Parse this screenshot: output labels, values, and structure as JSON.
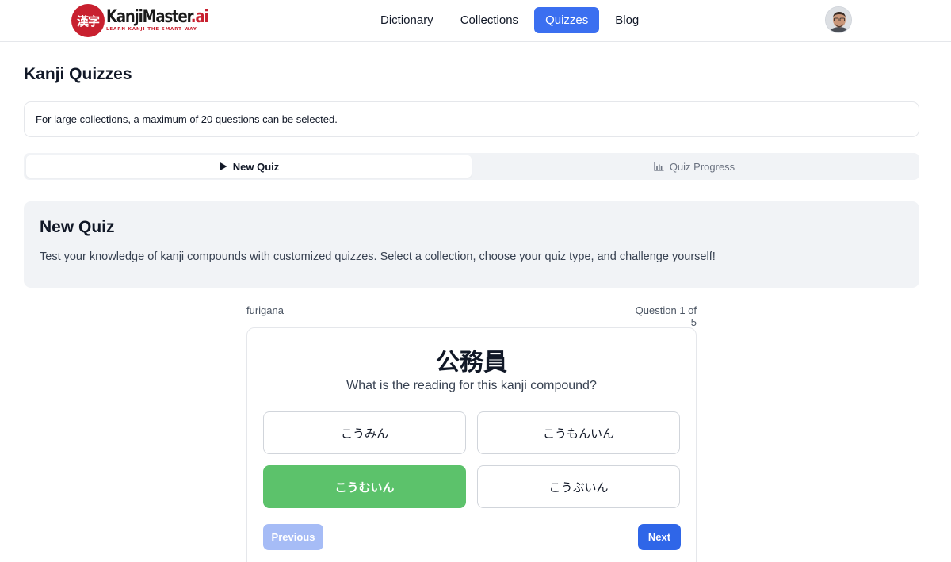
{
  "header": {
    "logo": {
      "mark": "漢字",
      "name": "KanjiMaster",
      "name_suffix": ".ai",
      "tagline": "LEARN KANJI THE SMART WAY"
    },
    "nav": [
      {
        "label": "Dictionary",
        "active": false
      },
      {
        "label": "Collections",
        "active": false
      },
      {
        "label": "Quizzes",
        "active": true
      },
      {
        "label": "Blog",
        "active": false
      }
    ]
  },
  "page": {
    "title": "Kanji Quizzes",
    "notice": "For large collections, a maximum of 20 questions can be selected."
  },
  "tabs": [
    {
      "label": "New Quiz",
      "icon": "play-icon",
      "active": true
    },
    {
      "label": "Quiz Progress",
      "icon": "chart-icon",
      "active": false
    }
  ],
  "hero": {
    "title": "New Quiz",
    "description": "Test your knowledge of kanji compounds with customized quizzes. Select a collection, choose your quiz type, and challenge yourself!"
  },
  "quiz": {
    "type": "furigana",
    "progress": "Question 1 of 5",
    "kanji": "公務員",
    "question": "What is the reading for this kanji compound?",
    "options": [
      "こうみん",
      "こうもんいん",
      "こうむいん",
      "こうぶいん"
    ],
    "correct_option": "こうむいん",
    "previous_label": "Previous",
    "next_label": "Next"
  },
  "colors": {
    "accent": "#3b6ff0",
    "correct": "#5cc26b",
    "brand_red": "#c8202f"
  }
}
